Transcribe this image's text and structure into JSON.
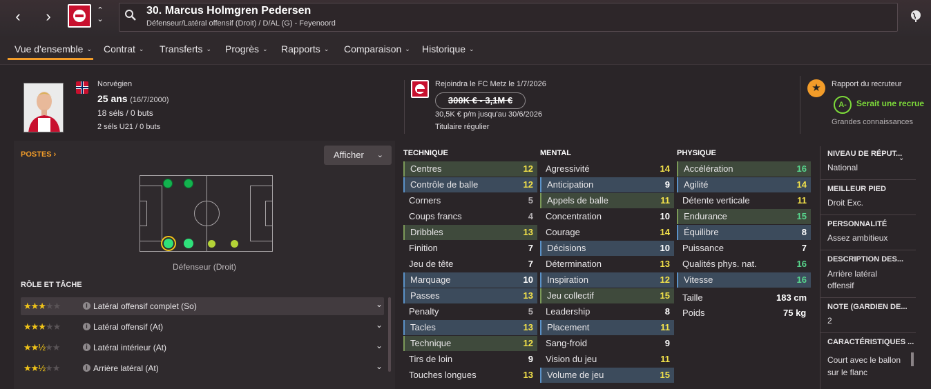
{
  "header": {
    "title": "30. Marcus Holmgren Pedersen",
    "subtitle": "Défenseur/Latéral offensif (Droit) / D/AL (G) - Feyenoord"
  },
  "tabs": [
    {
      "label": "Vue d'ensemble"
    },
    {
      "label": "Contrat"
    },
    {
      "label": "Transferts"
    },
    {
      "label": "Progrès"
    },
    {
      "label": "Rapports"
    },
    {
      "label": "Comparaison"
    },
    {
      "label": "Historique"
    }
  ],
  "player": {
    "nationality": "Norvégien",
    "age": "25 ans",
    "birth": "(16/7/2000)",
    "caps": "18 séls / 0 buts",
    "u21": "2 séls U21 / 0 buts"
  },
  "contract": {
    "joining": "Rejoindra le FC Metz le 1/7/2026",
    "value": "300K € - 3,1M €",
    "wage": "30,5K € p/m jusqu'au 30/6/2026",
    "status": "Titulaire régulier"
  },
  "scout": {
    "title": "Rapport du recruteur",
    "grade": "A-",
    "verdict": "Serait une recrue",
    "knowledge": "Grandes connaissances"
  },
  "positions": {
    "header": "POSTES",
    "display_button": "Afficher",
    "label": "Défenseur (Droit)"
  },
  "roles": {
    "header": "RÔLE ET TÂCHE",
    "items": [
      {
        "stars": "★★★",
        "off": "★★",
        "label": "Latéral offensif complet (So)"
      },
      {
        "stars": "★★★",
        "off": "★★",
        "label": "Latéral offensif (At)"
      },
      {
        "stars": "★★½",
        "off": "★★",
        "label": "Latéral intérieur (At)"
      },
      {
        "stars": "★★½",
        "off": "★★",
        "label": "Arrière latéral (At)"
      }
    ]
  },
  "attributes": {
    "technique_title": "TECHNIQUE",
    "mental_title": "MENTAL",
    "physique_title": "PHYSIQUE",
    "technique": [
      {
        "name": "Centres",
        "value": "12"
      },
      {
        "name": "Contrôle de balle",
        "value": "12"
      },
      {
        "name": "Corners",
        "value": "5"
      },
      {
        "name": "Coups francs",
        "value": "4"
      },
      {
        "name": "Dribbles",
        "value": "13"
      },
      {
        "name": "Finition",
        "value": "7"
      },
      {
        "name": "Jeu de tête",
        "value": "7"
      },
      {
        "name": "Marquage",
        "value": "10"
      },
      {
        "name": "Passes",
        "value": "13"
      },
      {
        "name": "Penalty",
        "value": "5"
      },
      {
        "name": "Tacles",
        "value": "13"
      },
      {
        "name": "Technique",
        "value": "12"
      },
      {
        "name": "Tirs de loin",
        "value": "9"
      },
      {
        "name": "Touches longues",
        "value": "13"
      }
    ],
    "mental": [
      {
        "name": "Agressivité",
        "value": "14"
      },
      {
        "name": "Anticipation",
        "value": "9"
      },
      {
        "name": "Appels de balle",
        "value": "11"
      },
      {
        "name": "Concentration",
        "value": "10"
      },
      {
        "name": "Courage",
        "value": "14"
      },
      {
        "name": "Décisions",
        "value": "10"
      },
      {
        "name": "Détermination",
        "value": "13"
      },
      {
        "name": "Inspiration",
        "value": "12"
      },
      {
        "name": "Jeu collectif",
        "value": "15"
      },
      {
        "name": "Leadership",
        "value": "8"
      },
      {
        "name": "Placement",
        "value": "11"
      },
      {
        "name": "Sang-froid",
        "value": "9"
      },
      {
        "name": "Vision du jeu",
        "value": "11"
      },
      {
        "name": "Volume de jeu",
        "value": "15"
      }
    ],
    "physique": [
      {
        "name": "Accélération",
        "value": "16"
      },
      {
        "name": "Agilité",
        "value": "14"
      },
      {
        "name": "Détente verticale",
        "value": "11"
      },
      {
        "name": "Endurance",
        "value": "15"
      },
      {
        "name": "Équilibre",
        "value": "8"
      },
      {
        "name": "Puissance",
        "value": "7"
      },
      {
        "name": "Qualités phys. nat.",
        "value": "16"
      },
      {
        "name": "Vitesse",
        "value": "16"
      }
    ],
    "height_label": "Taille",
    "height": "183 cm",
    "weight_label": "Poids",
    "weight": "75 kg"
  },
  "details": {
    "reputation_h": "NIVEAU DE RÉPUT...",
    "reputation": "National",
    "foot_h": "MEILLEUR PIED",
    "foot": "Droit Exc.",
    "personality_h": "PERSONNALITÉ",
    "personality": "Assez ambitieux",
    "description_h": "DESCRIPTION DES...",
    "description": "Arrière latéral offensif",
    "gk_h": "NOTE (GARDIEN DE...",
    "gk": "2",
    "traits_h": "CARACTÉRISTIQUES ...",
    "traits": "Court avec le ballon sur le flanc"
  },
  "colors": {
    "accent": "#f29c29",
    "value_yellow": "#f3e24a",
    "value_green": "#58d68d",
    "club_red": "#c8102e"
  }
}
